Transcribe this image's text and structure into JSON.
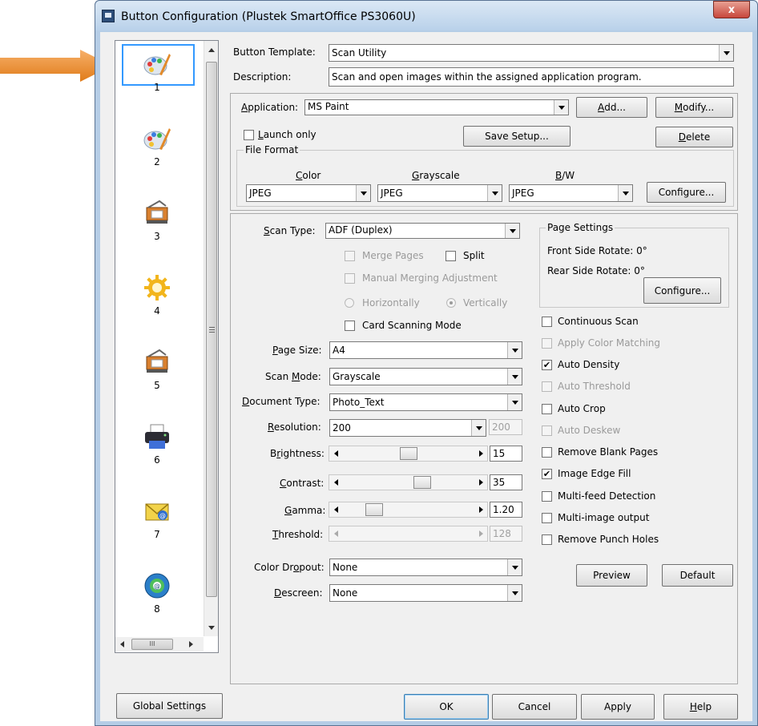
{
  "window": {
    "title": "Button Configuration (Plustek SmartOffice PS3060U)",
    "close_label": "x"
  },
  "sidebar": {
    "items": [
      {
        "num": "1",
        "icon": "paint-palette-icon",
        "selected": true
      },
      {
        "num": "2",
        "icon": "paint-palette-icon"
      },
      {
        "num": "3",
        "icon": "scanner-icon"
      },
      {
        "num": "4",
        "icon": "gear-sun-icon"
      },
      {
        "num": "5",
        "icon": "scanner-icon"
      },
      {
        "num": "6",
        "icon": "printer-icon"
      },
      {
        "num": "7",
        "icon": "email-icon"
      },
      {
        "num": "8",
        "icon": "globe-icon"
      }
    ],
    "hscroll_grip": "III"
  },
  "template": {
    "label": "Button Template:",
    "value": "Scan Utility",
    "desc_label": "Description:",
    "desc_value": "Scan and open images within the assigned application program."
  },
  "application": {
    "label": "Application:",
    "value": "MS Paint",
    "add": "Add...",
    "modify": "Modify...",
    "launch_only": "Launch only",
    "save_setup": "Save Setup...",
    "delete": "Delete"
  },
  "file_format": {
    "title": "File Format",
    "color_label": "Color",
    "gray_label": "Grayscale",
    "bw_label": "B/W",
    "color": "JPEG",
    "gray": "JPEG",
    "bw": "JPEG",
    "configure": "Configure..."
  },
  "scan": {
    "scan_type_label": "Scan Type:",
    "scan_type": "ADF (Duplex)",
    "merge_pages": "Merge Pages",
    "split": "Split",
    "manual_merge": "Manual Merging Adjustment",
    "horizontally": "Horizontally",
    "vertically": "Vertically",
    "card_mode": "Card Scanning Mode",
    "page_size_label": "Page Size:",
    "page_size": "A4",
    "scan_mode_label": "Scan Mode:",
    "scan_mode": "Grayscale",
    "doc_type_label": "Document Type:",
    "doc_type": "Photo_Text",
    "resolution_label": "Resolution:",
    "resolution": "200",
    "resolution2": "200",
    "brightness_label": "Brightness:",
    "brightness": "15",
    "brightness_level": 0.5,
    "contrast_label": "Contrast:",
    "contrast": "35",
    "contrast_level": 0.62,
    "gamma_label": "Gamma:",
    "gamma": "1.20",
    "gamma_level": 0.2,
    "threshold_label": "Threshold:",
    "threshold": "128",
    "dropout_label": "Color Dropout:",
    "dropout": "None",
    "descreen_label": "Descreen:",
    "descreen": "None"
  },
  "page_settings": {
    "title": "Page Settings",
    "front": "Front Side Rotate: 0°",
    "rear": "Rear Side Rotate: 0°",
    "configure": "Configure..."
  },
  "options": [
    {
      "label": "Continuous Scan",
      "checked": false,
      "enabled": true
    },
    {
      "label": "Apply Color Matching",
      "checked": false,
      "enabled": false
    },
    {
      "label": "Auto Density",
      "checked": true,
      "enabled": true
    },
    {
      "label": "Auto Threshold",
      "checked": false,
      "enabled": false
    },
    {
      "label": "Auto Crop",
      "checked": false,
      "enabled": true
    },
    {
      "label": "Auto Deskew",
      "checked": false,
      "enabled": false
    },
    {
      "label": "Remove Blank Pages",
      "checked": false,
      "enabled": true
    },
    {
      "label": "Image Edge Fill",
      "checked": true,
      "enabled": true
    },
    {
      "label": "Multi-feed Detection",
      "checked": false,
      "enabled": true
    },
    {
      "label": "Multi-image output",
      "checked": false,
      "enabled": true
    },
    {
      "label": "Remove Punch Holes",
      "checked": false,
      "enabled": true
    }
  ],
  "actions": {
    "preview": "Preview",
    "default": "Default"
  },
  "footer": {
    "global": "Global Settings",
    "ok": "OK",
    "cancel": "Cancel",
    "apply": "Apply",
    "help": "Help"
  },
  "colors": {
    "arrow": "#f0962e",
    "selection": "#3399ff",
    "title_bar": "#c4d9ee",
    "close": "#c7463b",
    "dialog_bg": "#f0f0f0"
  }
}
